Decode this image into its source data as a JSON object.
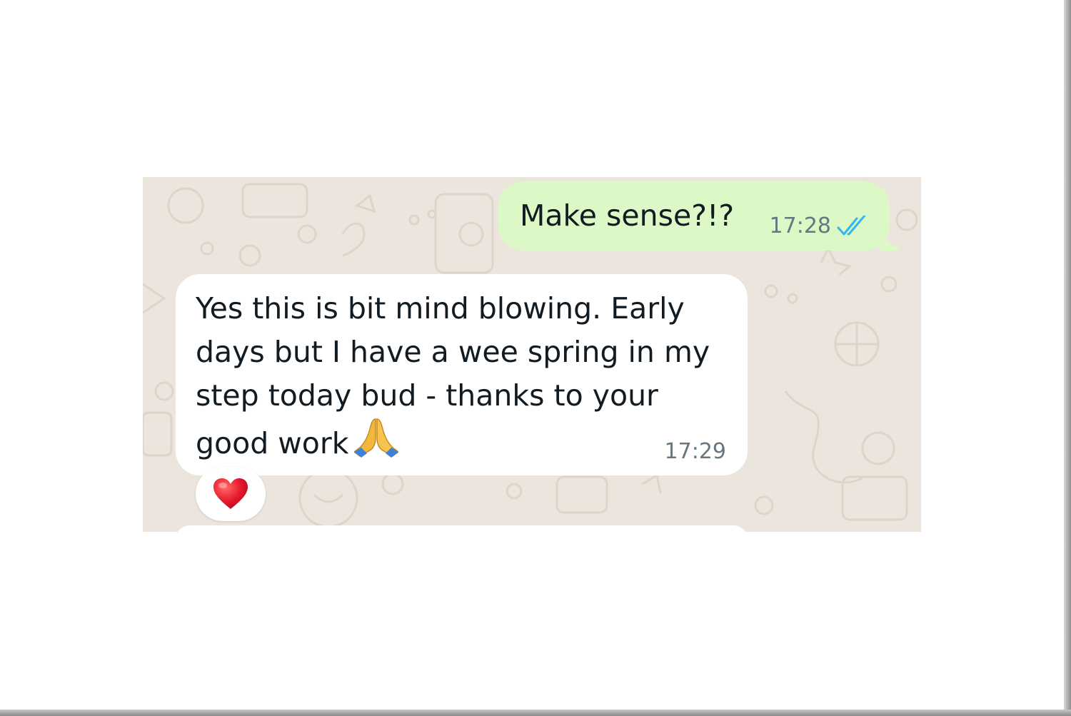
{
  "colors": {
    "chat_background": "#ece5dd",
    "outgoing_bubble": "#dcf8c6",
    "incoming_bubble": "#ffffff",
    "read_ticks": "#34b7f1",
    "timestamp": "#667781",
    "heart": "#e8182b"
  },
  "messages": {
    "outgoing": {
      "text": "Make sense?!?",
      "time": "17:28",
      "status_icon": "double-check-read-icon"
    },
    "incoming": {
      "text": "Yes this is bit mind blowing. Early days but I have a wee spring in my step today bud - thanks to your good work",
      "emoji": "folded-hands-icon",
      "time": "17:29",
      "reaction": "red-heart-icon"
    }
  }
}
